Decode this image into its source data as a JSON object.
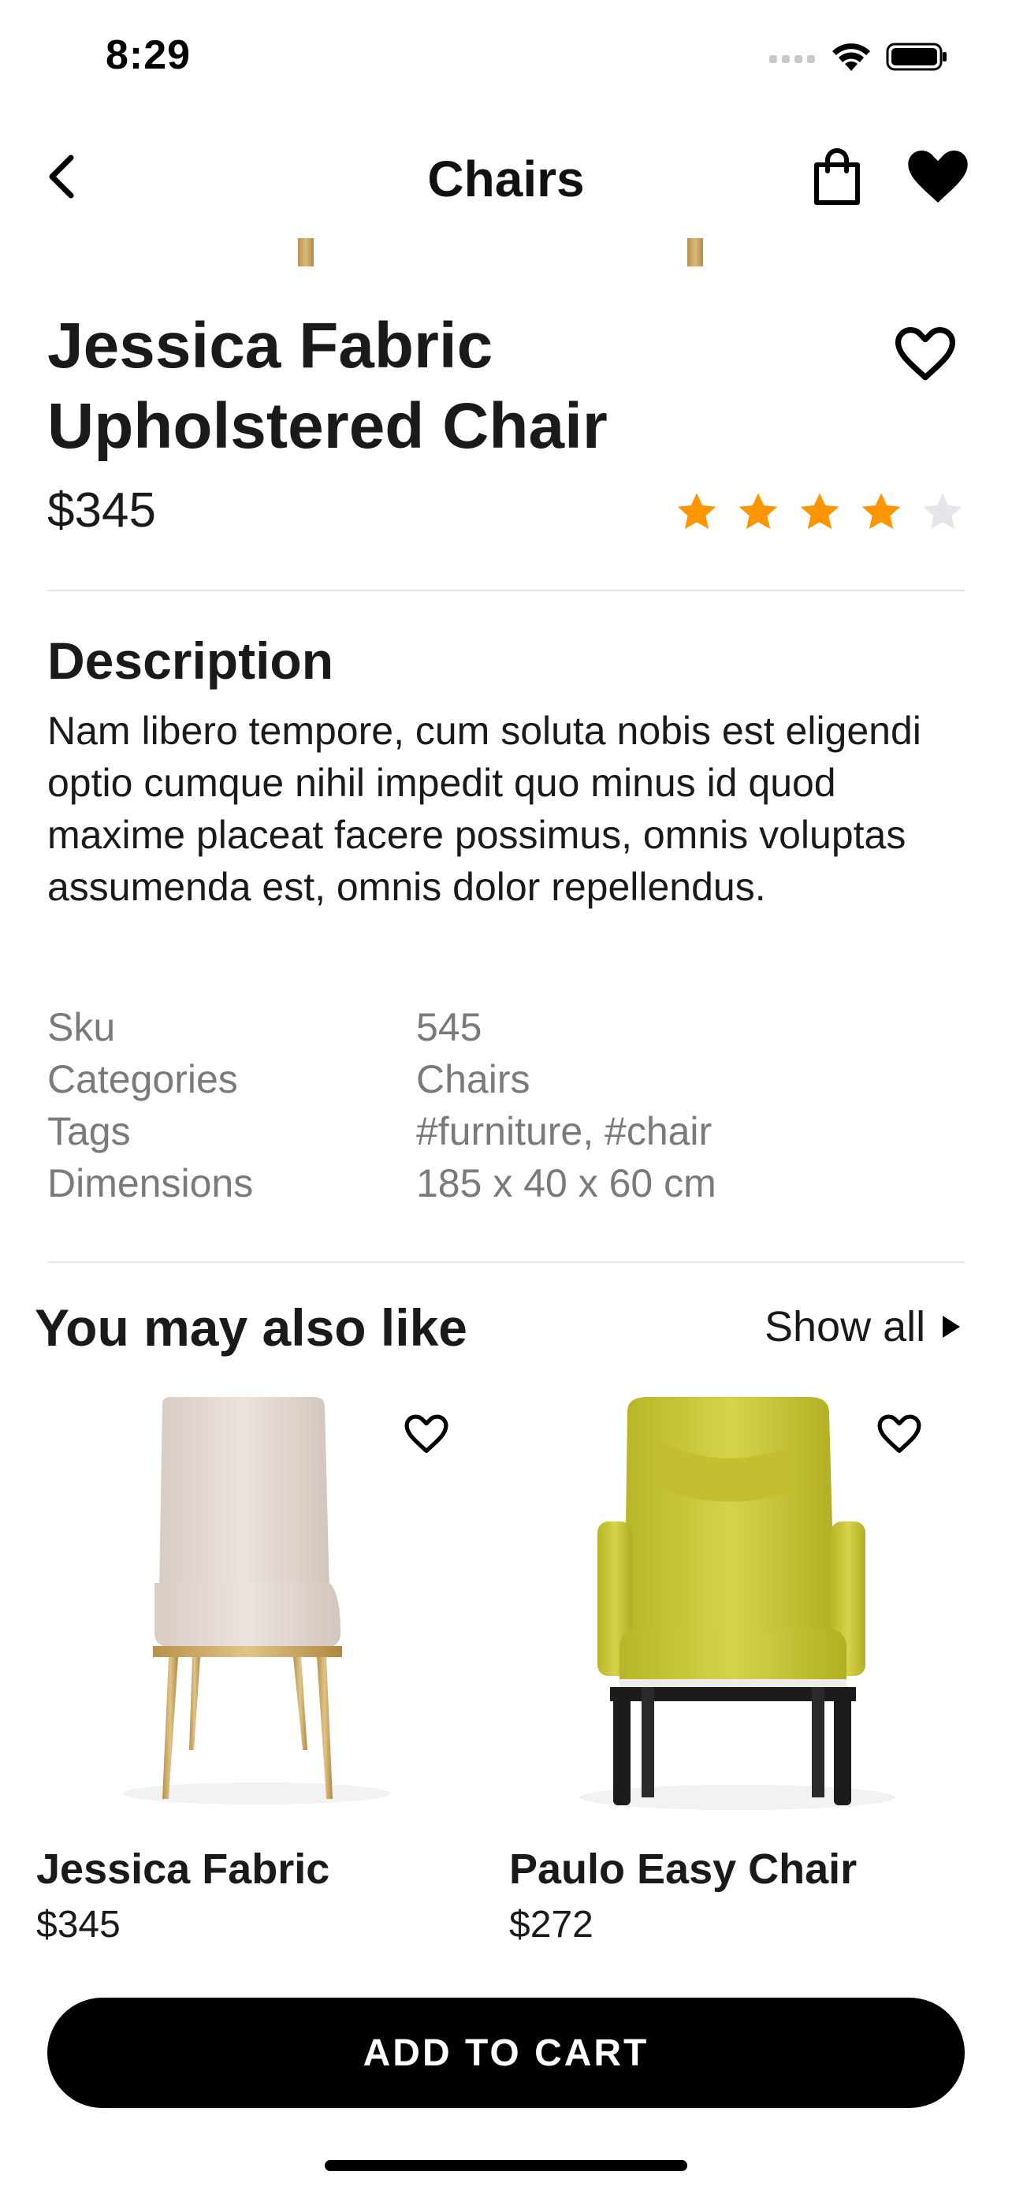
{
  "status_bar": {
    "time": "8:29",
    "icons": [
      "signal-icon",
      "wifi-icon",
      "battery-icon"
    ]
  },
  "nav": {
    "title": "Chairs",
    "icons": [
      "back-chevron-icon",
      "shopping-bag-icon",
      "heart-filled-icon"
    ]
  },
  "product": {
    "title": "Jessica Fabric Upholstered Chair",
    "price": "$345",
    "rating": 4,
    "rating_max": 5,
    "favorite_icon": "heart-outline-icon"
  },
  "description": {
    "heading": "Description",
    "text": "Nam libero tempore, cum soluta nobis est eligendi optio cumque nihil impedit quo minus id quod maxime placeat facere possimus, omnis voluptas assumenda est, omnis dolor repellendus."
  },
  "specs": [
    {
      "key": "Sku",
      "value": "545"
    },
    {
      "key": "Categories",
      "value": "Chairs"
    },
    {
      "key": "Tags",
      "value": "#furniture, #chair"
    },
    {
      "key": "Dimensions",
      "value": "185 x 40 x 60 cm"
    }
  ],
  "related": {
    "heading": "You may also like",
    "show_all": "Show all",
    "items": [
      {
        "name": "Jessica Fabric",
        "price": "$345"
      },
      {
        "name": "Paulo Easy Chair",
        "price": "$272"
      }
    ]
  },
  "cta": {
    "label": "ADD TO CART"
  },
  "colors": {
    "star_active": "#ff9500",
    "star_inactive": "#e5e5ea",
    "cta_bg": "#000000",
    "spec_text": "#7a7a7a"
  }
}
